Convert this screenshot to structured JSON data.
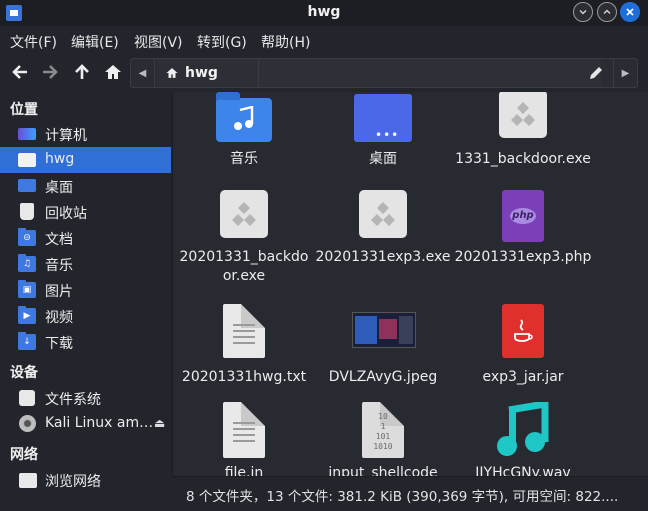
{
  "window": {
    "title": "hwg"
  },
  "menu": [
    "文件(F)",
    "编辑(E)",
    "视图(V)",
    "转到(G)",
    "帮助(H)"
  ],
  "path": {
    "current": "hwg"
  },
  "sidebar": {
    "places_title": "位置",
    "places": [
      "计算机",
      "hwg",
      "桌面",
      "回收站",
      "文档",
      "音乐",
      "图片",
      "视频",
      "下载"
    ],
    "devices_title": "设备",
    "devices": [
      "文件系统",
      "Kali Linux am…"
    ],
    "network_title": "网络",
    "network": [
      "浏览网络"
    ]
  },
  "files": [
    {
      "name": "音乐"
    },
    {
      "name": "桌面"
    },
    {
      "name": "1331_backdoor.exe"
    },
    {
      "name": "20201331_backdoor.exe"
    },
    {
      "name": "20201331exp3.exe"
    },
    {
      "name": "20201331exp3.php"
    },
    {
      "name": "20201331hwg.txt"
    },
    {
      "name": "DVLZAvyG.jpeg"
    },
    {
      "name": "exp3_jar.jar"
    },
    {
      "name": "file.in"
    },
    {
      "name": "input_shellcode"
    },
    {
      "name": "JIYHcGNy.wav"
    }
  ],
  "status": {
    "text": "8 个文件夹，13 个文件: 381.2 KiB (390,369 字节), 可用空间: 822...."
  },
  "colors": {
    "accent": "#2f6fd6",
    "folder": "#3d85ea",
    "music": "#1fc6c6",
    "php": "#7b3fb8",
    "jar": "#e0302d"
  }
}
